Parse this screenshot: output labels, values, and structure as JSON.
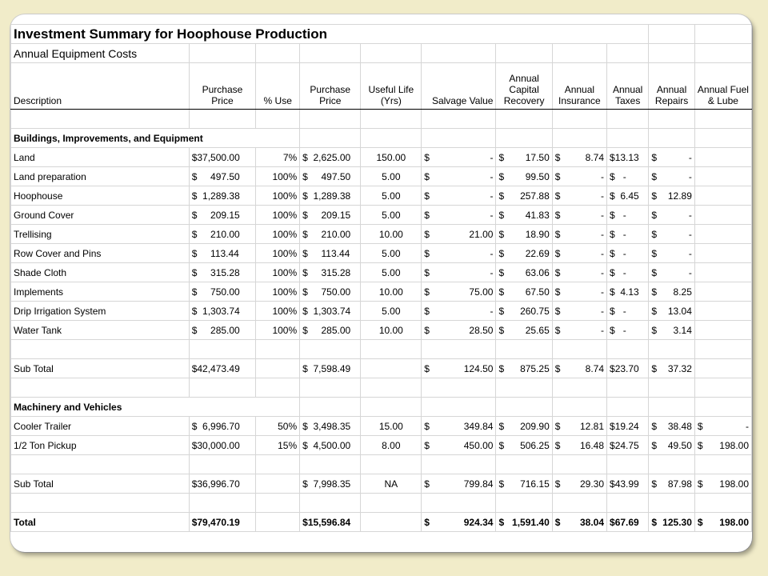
{
  "title": "Investment Summary for Hoophouse Production",
  "subtitle": "Annual Equipment Costs",
  "headers": {
    "description": "Description",
    "purchase_price": [
      "Purchase",
      "Price"
    ],
    "pct_use": "% Use",
    "purchase_price2": [
      "Purchase",
      "Price"
    ],
    "useful_life": [
      "Useful Life",
      "(Yrs)"
    ],
    "salvage_value": "Salvage Value",
    "annual_capital_recovery": [
      "Annual",
      "Capital",
      "Recovery"
    ],
    "annual_insurance": [
      "Annual",
      "Insurance"
    ],
    "annual_taxes": [
      "Annual",
      "Taxes"
    ],
    "annual_repairs": [
      "Annual",
      "Repairs"
    ],
    "annual_fuel_lube": [
      "Annual Fuel",
      "& Lube"
    ]
  },
  "sections": {
    "buildings": "Buildings, Improvements, and Equipment",
    "machinery": "Machinery and Vehicles"
  },
  "rows_buildings": [
    {
      "desc": "Land",
      "pp": "$37,500.00",
      "use": "7%",
      "pp2": "$  2,625.00",
      "life": "150.00",
      "salv_s": "$",
      "salv": "-",
      "cap_s": "$",
      "cap": "17.50",
      "ins_s": "$",
      "ins": "8.74",
      "tax": "$13.13",
      "rep_s": "$",
      "rep": "-",
      "fuel_s": "",
      "fuel": ""
    },
    {
      "desc": "Land preparation",
      "pp": "$     497.50",
      "use": "100%",
      "pp2": "$     497.50",
      "life": "5.00",
      "salv_s": "$",
      "salv": "-",
      "cap_s": "$",
      "cap": "99.50",
      "ins_s": "$",
      "ins": "-",
      "tax": "$   -",
      "rep_s": "$",
      "rep": "-",
      "fuel_s": "",
      "fuel": ""
    },
    {
      "desc": "Hoophouse",
      "pp": "$  1,289.38",
      "use": "100%",
      "pp2": "$  1,289.38",
      "life": "5.00",
      "salv_s": "$",
      "salv": "-",
      "cap_s": "$",
      "cap": "257.88",
      "ins_s": "$",
      "ins": "-",
      "tax": "$  6.45",
      "rep_s": "$",
      "rep": "12.89",
      "fuel_s": "",
      "fuel": ""
    },
    {
      "desc": "Ground Cover",
      "pp": "$     209.15",
      "use": "100%",
      "pp2": "$     209.15",
      "life": "5.00",
      "salv_s": "$",
      "salv": "-",
      "cap_s": "$",
      "cap": "41.83",
      "ins_s": "$",
      "ins": "-",
      "tax": "$   -",
      "rep_s": "$",
      "rep": "-",
      "fuel_s": "",
      "fuel": ""
    },
    {
      "desc": "Trellising",
      "pp": "$     210.00",
      "use": "100%",
      "pp2": "$     210.00",
      "life": "10.00",
      "salv_s": "$",
      "salv": "21.00",
      "cap_s": "$",
      "cap": "18.90",
      "ins_s": "$",
      "ins": "-",
      "tax": "$   -",
      "rep_s": "$",
      "rep": "-",
      "fuel_s": "",
      "fuel": ""
    },
    {
      "desc": "Row Cover and Pins",
      "pp": "$     113.44",
      "use": "100%",
      "pp2": "$     113.44",
      "life": "5.00",
      "salv_s": "$",
      "salv": "-",
      "cap_s": "$",
      "cap": "22.69",
      "ins_s": "$",
      "ins": "-",
      "tax": "$   -",
      "rep_s": "$",
      "rep": "-",
      "fuel_s": "",
      "fuel": ""
    },
    {
      "desc": "Shade Cloth",
      "pp": "$     315.28",
      "use": "100%",
      "pp2": "$     315.28",
      "life": "5.00",
      "salv_s": "$",
      "salv": "-",
      "cap_s": "$",
      "cap": "63.06",
      "ins_s": "$",
      "ins": "-",
      "tax": "$   -",
      "rep_s": "$",
      "rep": "-",
      "fuel_s": "",
      "fuel": ""
    },
    {
      "desc": "Implements",
      "pp": "$     750.00",
      "use": "100%",
      "pp2": "$     750.00",
      "life": "10.00",
      "salv_s": "$",
      "salv": "75.00",
      "cap_s": "$",
      "cap": "67.50",
      "ins_s": "$",
      "ins": "-",
      "tax": "$  4.13",
      "rep_s": "$",
      "rep": "8.25",
      "fuel_s": "",
      "fuel": ""
    },
    {
      "desc": "Drip Irrigation System",
      "pp": "$  1,303.74",
      "use": "100%",
      "pp2": "$  1,303.74",
      "life": "5.00",
      "salv_s": "$",
      "salv": "-",
      "cap_s": "$",
      "cap": "260.75",
      "ins_s": "$",
      "ins": "-",
      "tax": "$   -",
      "rep_s": "$",
      "rep": "13.04",
      "fuel_s": "",
      "fuel": ""
    },
    {
      "desc": "Water Tank",
      "pp": "$     285.00",
      "use": "100%",
      "pp2": "$     285.00",
      "life": "10.00",
      "salv_s": "$",
      "salv": "28.50",
      "cap_s": "$",
      "cap": "25.65",
      "ins_s": "$",
      "ins": "-",
      "tax": "$   -",
      "rep_s": "$",
      "rep": "3.14",
      "fuel_s": "",
      "fuel": ""
    }
  ],
  "subtotal_buildings": {
    "desc": "Sub Total",
    "pp": "$42,473.49",
    "use": "",
    "pp2": "$  7,598.49",
    "life": "",
    "salv_s": "$",
    "salv": "124.50",
    "cap_s": "$",
    "cap": "875.25",
    "ins_s": "$",
    "ins": "8.74",
    "tax": "$23.70",
    "rep_s": "$",
    "rep": "37.32",
    "fuel_s": "",
    "fuel": ""
  },
  "rows_machinery": [
    {
      "desc": "Cooler Trailer",
      "pp": "$  6,996.70",
      "use": "50%",
      "pp2": "$  3,498.35",
      "life": "15.00",
      "salv_s": "$",
      "salv": "349.84",
      "cap_s": "$",
      "cap": "209.90",
      "ins_s": "$",
      "ins": "12.81",
      "tax": "$19.24",
      "rep_s": "$",
      "rep": "38.48",
      "fuel_s": "$",
      "fuel": "-"
    },
    {
      "desc": "1/2 Ton Pickup",
      "pp": "$30,000.00",
      "use": "15%",
      "pp2": "$  4,500.00",
      "life": "8.00",
      "salv_s": "$",
      "salv": "450.00",
      "cap_s": "$",
      "cap": "506.25",
      "ins_s": "$",
      "ins": "16.48",
      "tax": "$24.75",
      "rep_s": "$",
      "rep": "49.50",
      "fuel_s": "$",
      "fuel": "198.00"
    }
  ],
  "subtotal_machinery": {
    "desc": "Sub Total",
    "pp": "$36,996.70",
    "use": "",
    "pp2": "$  7,998.35",
    "life": "NA",
    "salv_s": "$",
    "salv": "799.84",
    "cap_s": "$",
    "cap": "716.15",
    "ins_s": "$",
    "ins": "29.30",
    "tax": "$43.99",
    "rep_s": "$",
    "rep": "87.98",
    "fuel_s": "$",
    "fuel": "198.00"
  },
  "total": {
    "desc": "Total",
    "pp": "$79,470.19",
    "use": "",
    "pp2": "$15,596.84",
    "life": "",
    "salv_s": "$",
    "salv": "924.34",
    "cap_s": "$",
    "cap": "1,591.40",
    "ins_s": "$",
    "ins": "38.04",
    "tax": "$67.69",
    "rep_s": "$",
    "rep": "125.30",
    "fuel_s": "$",
    "fuel": "198.00"
  }
}
